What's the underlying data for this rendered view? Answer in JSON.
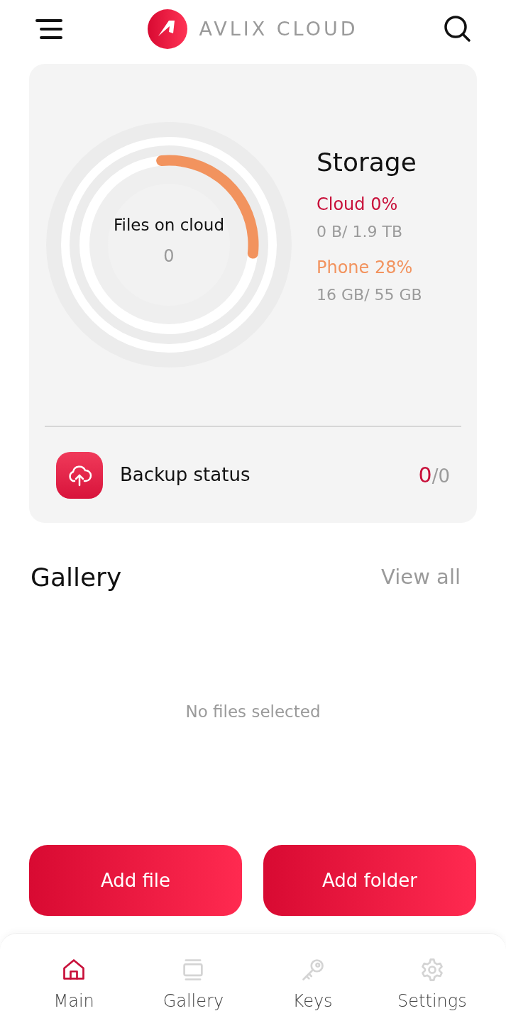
{
  "header": {
    "brand": "AVLIX CLOUD"
  },
  "storage": {
    "ring": {
      "label": "Files on cloud",
      "count": "0",
      "level": 0.28
    },
    "title": "Storage",
    "items": [
      {
        "label": "Cloud 0%",
        "usage": "0 B/ 1.9 TB",
        "color": "#c8103a"
      },
      {
        "label": "Phone 28%",
        "usage": "16 GB/ 55 GB",
        "color": "#f2935e"
      }
    ]
  },
  "backup": {
    "label": "Backup status",
    "done": "0",
    "total": "/0"
  },
  "gallery": {
    "title": "Gallery",
    "view_all": "View all",
    "empty": "No files selected"
  },
  "buttons": [
    "Add file",
    "Add folder"
  ],
  "nav": [
    {
      "label": "Main",
      "kind": "home",
      "selected": true
    },
    {
      "label": "Gallery",
      "kind": "gallery",
      "selected": false
    },
    {
      "label": "Keys",
      "kind": "key",
      "selected": false
    },
    {
      "label": "Settings",
      "kind": "gear",
      "selected": false
    }
  ]
}
